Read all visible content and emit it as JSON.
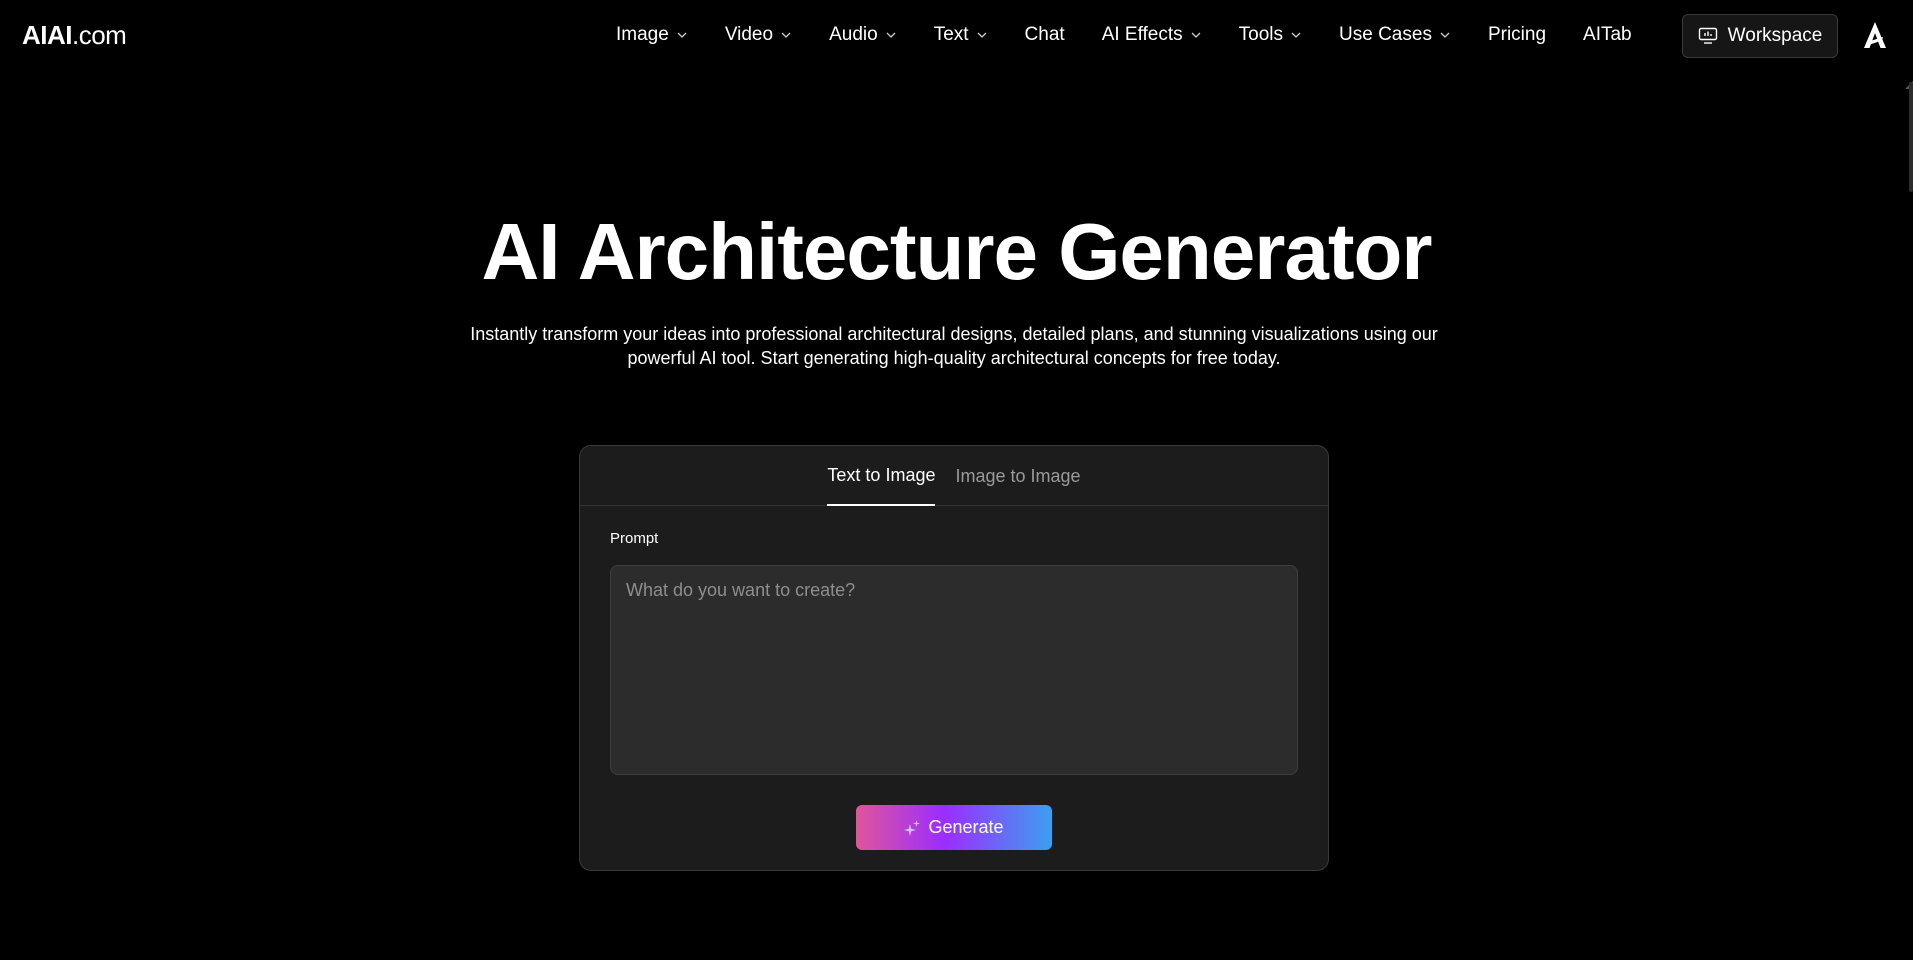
{
  "header": {
    "logo_bold": "AIAI",
    "logo_light": ".com",
    "nav": [
      {
        "label": "Image",
        "has_dropdown": true,
        "icon": "chevron-down-icon"
      },
      {
        "label": "Video",
        "has_dropdown": true,
        "icon": "chevron-down-icon"
      },
      {
        "label": "Audio",
        "has_dropdown": true,
        "icon": "chevron-down-icon"
      },
      {
        "label": "Text",
        "has_dropdown": true,
        "icon": "chevron-down-icon"
      },
      {
        "label": "Chat",
        "has_dropdown": false
      },
      {
        "label": "AI Effects",
        "has_dropdown": true,
        "icon": "chevron-down-icon"
      },
      {
        "label": "Tools",
        "has_dropdown": true,
        "icon": "chevron-down-icon"
      },
      {
        "label": "Use Cases",
        "has_dropdown": true,
        "icon": "chevron-down-icon"
      },
      {
        "label": "Pricing",
        "has_dropdown": false
      },
      {
        "label": "AITab",
        "has_dropdown": false
      }
    ],
    "workspace_label": "Workspace",
    "workspace_icon": "monitor-icon",
    "user_icon": "brand-a-icon"
  },
  "hero": {
    "title": "AI Architecture Generator",
    "subtitle": "Instantly transform your ideas into professional architectural designs, detailed plans, and stunning visualizations using our powerful AI tool. Start generating high-quality architectural concepts for free today."
  },
  "generator": {
    "tabs": [
      {
        "label": "Text to Image",
        "active": true
      },
      {
        "label": "Image to Image",
        "active": false
      }
    ],
    "prompt_label": "Prompt",
    "prompt_placeholder": "What do you want to create?",
    "prompt_value": "",
    "generate_label": "Generate",
    "generate_icon": "sparkle-icon"
  },
  "colors": {
    "background": "#000000",
    "card_bg": "#1c1c1c",
    "input_bg": "#2c2c2c",
    "gradient_start": "#e0559a",
    "gradient_mid": "#9b2dff",
    "gradient_end": "#3aa0f0"
  }
}
